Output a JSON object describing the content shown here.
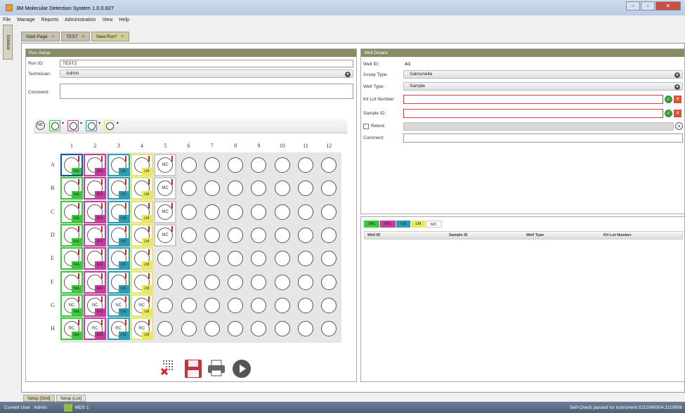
{
  "window": {
    "title": "3M Molecular Detection System 1.0.0.827"
  },
  "menu": [
    "File",
    "Manage",
    "Reports",
    "Administration",
    "View",
    "Help"
  ],
  "sidebar_tab": "Sidebar",
  "tabs": [
    {
      "label": "Start Page",
      "active": false
    },
    {
      "label": "TEST",
      "active": false
    },
    {
      "label": "New Run*",
      "active": true
    }
  ],
  "run_setup": {
    "header": "Run Setup",
    "run_id_label": "Run ID:",
    "run_id_value": "TEST2",
    "technician_label": "Technician:",
    "technician_value": "Admin",
    "comment_label": "Comment:",
    "comment_value": ""
  },
  "plate": {
    "columns": [
      "1",
      "2",
      "3",
      "4",
      "5",
      "6",
      "7",
      "8",
      "9",
      "10",
      "11",
      "12"
    ],
    "rows": [
      "A",
      "B",
      "C",
      "D",
      "E",
      "F",
      "G",
      "H"
    ],
    "wells": [
      [
        "SAL",
        "E01",
        "LIS",
        "LM",
        "MC",
        "",
        "",
        "",
        "",
        "",
        "",
        ""
      ],
      [
        "SAL",
        "E01",
        "LIS",
        "LM",
        "MC",
        "",
        "",
        "",
        "",
        "",
        "",
        ""
      ],
      [
        "SAL",
        "E01",
        "LIS",
        "LM",
        "MC",
        "",
        "",
        "",
        "",
        "",
        "",
        ""
      ],
      [
        "SAL",
        "E01",
        "LIS",
        "LM",
        "MC",
        "",
        "",
        "",
        "",
        "",
        "",
        ""
      ],
      [
        "SAL",
        "E01",
        "LIS",
        "LM",
        "",
        "",
        "",
        "",
        "",
        "",
        "",
        ""
      ],
      [
        "SAL",
        "E01",
        "LIS",
        "LM",
        "",
        "",
        "",
        "",
        "",
        "",
        "",
        ""
      ],
      [
        "SAL",
        "E01",
        "LIS",
        "LM",
        "",
        "",
        "",
        "",
        "",
        "",
        "",
        ""
      ],
      [
        "SAL",
        "E01",
        "LIS",
        "LM",
        "",
        "",
        "",
        "",
        "",
        "",
        "",
        ""
      ]
    ],
    "row_center_text": {
      "G": "NC",
      "H": "RC"
    },
    "mc_text": "MC"
  },
  "assay_colors": {
    "SAL": "#3cc83c",
    "E01": "#c43c9c",
    "LIS": "#2a9cb4",
    "LM": "#e8e860",
    "MC": "#ffffff"
  },
  "toolbar_icons": [
    "mc-icon",
    "sal-well-icon",
    "e01-well-icon",
    "lis-well-icon",
    "lm-well-icon"
  ],
  "footer_icons": [
    "clear-plate-icon",
    "save-icon",
    "print-icon",
    "start-run-icon"
  ],
  "well_details": {
    "header": "Well Details",
    "well_id_label": "Well ID:",
    "well_id_value": "A1",
    "assay_type_label": "Assay Type:",
    "assay_type_value": "Salmonella",
    "well_type_label": "Well Type:",
    "well_type_value": "Sample",
    "kit_lot_label": "Kit Lot Number:",
    "sample_id_label": "Sample ID:",
    "retest_label": "Retest:",
    "comment_label": "Comment:"
  },
  "well_list": {
    "legend": [
      "SAL",
      "E01",
      "LIS",
      "LM",
      "MC"
    ],
    "columns": [
      "Well ID",
      "Sample ID",
      "Well Type",
      "Kit Lot Number"
    ]
  },
  "bottom_tabs": [
    "Setup (Grid)",
    "Setup (List)"
  ],
  "status": {
    "user": "Current User : Admin",
    "instrument": "MDS 1",
    "message": "Self-Check passed for instrument 0211060004.2110606"
  }
}
